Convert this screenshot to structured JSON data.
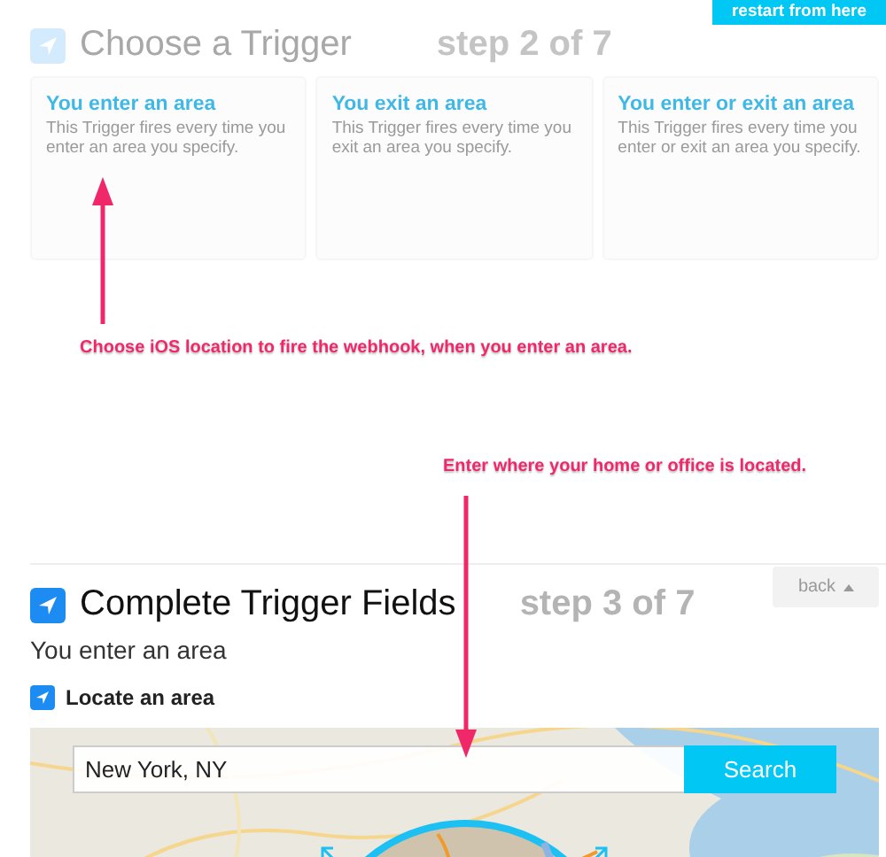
{
  "header_button": "restart from here",
  "previous_step": {
    "title": "Choose a Trigger",
    "step": "step 2 of 7",
    "cards": [
      {
        "title": "You enter an area",
        "description": "This Trigger fires every time you enter an area you specify."
      },
      {
        "title": "You exit an area",
        "description": "This Trigger fires every time you exit an area you specify."
      },
      {
        "title": "You enter or exit an area",
        "description": "This Trigger fires every time you enter or exit an area you specify."
      }
    ]
  },
  "annotations": [
    {
      "text": "Choose iOS location to fire the webhook, when you enter an area."
    },
    {
      "text": "Enter where your home or office is located."
    }
  ],
  "current_step": {
    "title": "Complete Trigger Fields",
    "step": "step 3 of 7",
    "back_button": "back",
    "trigger": "You enter an area",
    "field_label": "Locate an area",
    "search": {
      "value": "New York, NY",
      "button": "Search"
    }
  }
}
